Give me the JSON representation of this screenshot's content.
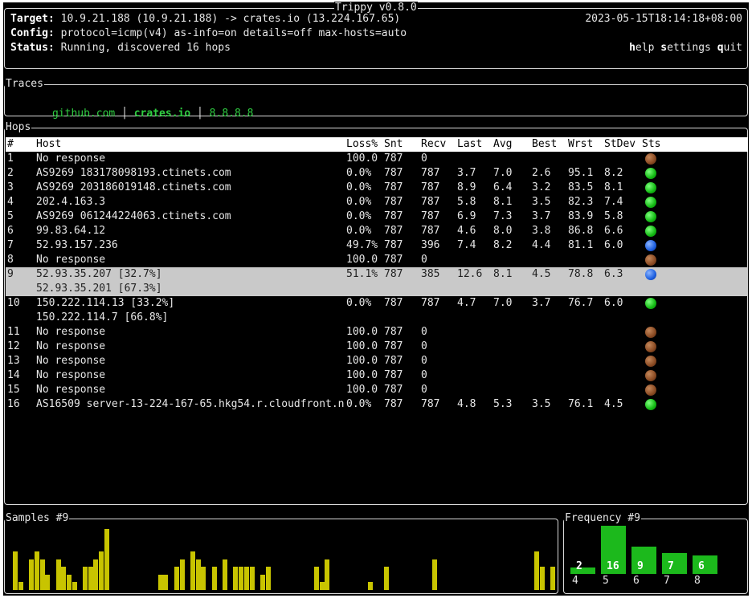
{
  "header": {
    "title": "Trippy v0.8.0",
    "target_label": "Target:",
    "target_value": " 10.9.21.188 (10.9.21.188) -> crates.io (13.224.167.65)",
    "config_label": "Config:",
    "config_value": " protocol=icmp(v4) as-info=on details=off max-hosts=auto",
    "status_label": "Status:",
    "status_value": " Running, discovered 16 hops",
    "timestamp": "2023-05-15T18:14:18+08:00",
    "help_key": "h",
    "help_rest": "elp",
    "settings_key": "s",
    "settings_rest": "ettings",
    "quit_key": "q",
    "quit_rest": "uit"
  },
  "traces": {
    "title": "Traces",
    "tabs": [
      {
        "label": "github.com",
        "active": false
      },
      {
        "label": "crates.io",
        "active": true
      },
      {
        "label": "8.8.8.8",
        "active": false
      }
    ],
    "separator": "│"
  },
  "hops": {
    "title": "Hops",
    "columns": [
      "#",
      "Host",
      "Loss%",
      "Snt",
      "Recv",
      "Last",
      "Avg",
      "Best",
      "Wrst",
      "StDev",
      "Sts"
    ],
    "rows": [
      {
        "n": "1",
        "host": [
          "No response"
        ],
        "loss": "100.0",
        "snt": "787",
        "recv": "0",
        "last": "",
        "avg": "",
        "best": "",
        "wrst": "",
        "stdev": "",
        "sts": "brown"
      },
      {
        "n": "2",
        "host": [
          "AS9269 183178098193.ctinets.com"
        ],
        "loss": "0.0%",
        "snt": "787",
        "recv": "787",
        "last": "3.7",
        "avg": "7.0",
        "best": "2.6",
        "wrst": "95.1",
        "stdev": "8.2",
        "sts": "green"
      },
      {
        "n": "3",
        "host": [
          "AS9269 203186019148.ctinets.com"
        ],
        "loss": "0.0%",
        "snt": "787",
        "recv": "787",
        "last": "8.9",
        "avg": "6.4",
        "best": "3.2",
        "wrst": "83.5",
        "stdev": "8.1",
        "sts": "green"
      },
      {
        "n": "4",
        "host": [
          "202.4.163.3"
        ],
        "loss": "0.0%",
        "snt": "787",
        "recv": "787",
        "last": "5.8",
        "avg": "8.1",
        "best": "3.5",
        "wrst": "82.3",
        "stdev": "7.4",
        "sts": "green"
      },
      {
        "n": "5",
        "host": [
          "AS9269 061244224063.ctinets.com"
        ],
        "loss": "0.0%",
        "snt": "787",
        "recv": "787",
        "last": "6.9",
        "avg": "7.3",
        "best": "3.7",
        "wrst": "83.9",
        "stdev": "5.8",
        "sts": "green"
      },
      {
        "n": "6",
        "host": [
          "99.83.64.12"
        ],
        "loss": "0.0%",
        "snt": "787",
        "recv": "787",
        "last": "4.6",
        "avg": "8.0",
        "best": "3.8",
        "wrst": "86.8",
        "stdev": "6.6",
        "sts": "green"
      },
      {
        "n": "7",
        "host": [
          "52.93.157.236"
        ],
        "loss": "49.7%",
        "snt": "787",
        "recv": "396",
        "last": "7.4",
        "avg": "8.2",
        "best": "4.4",
        "wrst": "81.1",
        "stdev": "6.0",
        "sts": "blue"
      },
      {
        "n": "8",
        "host": [
          "No response"
        ],
        "loss": "100.0",
        "snt": "787",
        "recv": "0",
        "last": "",
        "avg": "",
        "best": "",
        "wrst": "",
        "stdev": "",
        "sts": "brown"
      },
      {
        "n": "9",
        "host": [
          "52.93.35.207 [32.7%]",
          "52.93.35.201 [67.3%]"
        ],
        "loss": "51.1%",
        "snt": "787",
        "recv": "385",
        "last": "12.6",
        "avg": "8.1",
        "best": "4.5",
        "wrst": "78.8",
        "stdev": "6.3",
        "sts": "blue",
        "selected": true
      },
      {
        "n": "10",
        "host": [
          "150.222.114.13 [33.2%]",
          "150.222.114.7 [66.8%]"
        ],
        "loss": "0.0%",
        "snt": "787",
        "recv": "787",
        "last": "4.7",
        "avg": "7.0",
        "best": "3.7",
        "wrst": "76.7",
        "stdev": "6.0",
        "sts": "green"
      },
      {
        "n": "11",
        "host": [
          "No response"
        ],
        "loss": "100.0",
        "snt": "787",
        "recv": "0",
        "last": "",
        "avg": "",
        "best": "",
        "wrst": "",
        "stdev": "",
        "sts": "brown"
      },
      {
        "n": "12",
        "host": [
          "No response"
        ],
        "loss": "100.0",
        "snt": "787",
        "recv": "0",
        "last": "",
        "avg": "",
        "best": "",
        "wrst": "",
        "stdev": "",
        "sts": "brown"
      },
      {
        "n": "13",
        "host": [
          "No response"
        ],
        "loss": "100.0",
        "snt": "787",
        "recv": "0",
        "last": "",
        "avg": "",
        "best": "",
        "wrst": "",
        "stdev": "",
        "sts": "brown"
      },
      {
        "n": "14",
        "host": [
          "No response"
        ],
        "loss": "100.0",
        "snt": "787",
        "recv": "0",
        "last": "",
        "avg": "",
        "best": "",
        "wrst": "",
        "stdev": "",
        "sts": "brown"
      },
      {
        "n": "15",
        "host": [
          "No response"
        ],
        "loss": "100.0",
        "snt": "787",
        "recv": "0",
        "last": "",
        "avg": "",
        "best": "",
        "wrst": "",
        "stdev": "",
        "sts": "brown"
      },
      {
        "n": "16",
        "host": [
          "AS16509 server-13-224-167-65.hkg54.r.cloudfront.n"
        ],
        "loss": "0.0%",
        "snt": "787",
        "recv": "787",
        "last": "4.8",
        "avg": "5.3",
        "best": "3.5",
        "wrst": "76.1",
        "stdev": "4.5",
        "sts": "green"
      }
    ]
  },
  "colors": {
    "status_green": "#12b912",
    "status_blue": "#1d5fe0",
    "status_brown": "#8a4a22",
    "sparkline": "#c8c400",
    "frequency": "#1cb91c",
    "selected_row": "#c9c9c9"
  },
  "samples": {
    "title": "Samples #9",
    "values": [
      5,
      1,
      0,
      4,
      5,
      4,
      2,
      0,
      4,
      3,
      2,
      1,
      0,
      3,
      3,
      4,
      5,
      8,
      0,
      0,
      0,
      0,
      0,
      0,
      0,
      0,
      0,
      2,
      2,
      0,
      3,
      4,
      0,
      5,
      4,
      3,
      0,
      3,
      0,
      4,
      0,
      3,
      3,
      3,
      3,
      0,
      2,
      3,
      0,
      0,
      0,
      0,
      0,
      0,
      0,
      0,
      3,
      1,
      4,
      0,
      0,
      0,
      0,
      0,
      0,
      0,
      1,
      0,
      0,
      3,
      0,
      0,
      0,
      0,
      0,
      0,
      0,
      0,
      4,
      0,
      0,
      0,
      0,
      0,
      0,
      0,
      0,
      0,
      0,
      0,
      0,
      0,
      0,
      0,
      0,
      0,
      0,
      5,
      3,
      0,
      3
    ]
  },
  "frequency": {
    "title": "Frequency #9",
    "bins": [
      {
        "x": "4",
        "count": "2",
        "value": 2
      },
      {
        "x": "5",
        "count": "16",
        "value": 16
      },
      {
        "x": "6",
        "count": "9",
        "value": 9
      },
      {
        "x": "7",
        "count": "7",
        "value": 7
      },
      {
        "x": "8",
        "count": "6",
        "value": 6
      }
    ]
  }
}
